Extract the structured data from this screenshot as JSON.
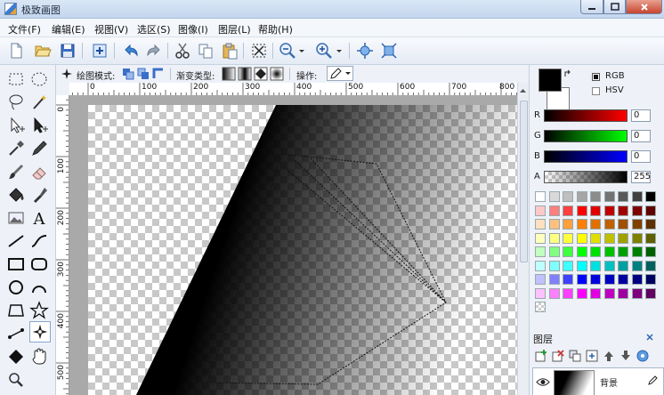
{
  "window": {
    "title": "极致画图"
  },
  "menu": [
    "文件(F)",
    "编辑(E)",
    "视图(V)",
    "选区(S)",
    "图像(I)",
    "图层(L)",
    "帮助(H)"
  ],
  "options": {
    "draw_mode_label": "绘图模式:",
    "gradient_type_label": "渐变类型:",
    "operation_label": "操作:"
  },
  "ruler": {
    "h_labels": [
      "0",
      "100",
      "200",
      "300",
      "400",
      "500",
      "600",
      "700",
      "800"
    ],
    "v_labels": [
      "0",
      "100",
      "200",
      "300",
      "400",
      "500"
    ]
  },
  "color": {
    "mode_rgb": "RGB",
    "mode_hsv": "HSV",
    "rgb_selected": true,
    "channels": [
      {
        "label": "R",
        "value": "0"
      },
      {
        "label": "G",
        "value": "0"
      },
      {
        "label": "B",
        "value": "0"
      },
      {
        "label": "A",
        "value": "255"
      }
    ],
    "primary": "#000000",
    "secondary": "#ffffff"
  },
  "palette": [
    [
      "#ffffff",
      "#d9d9d9",
      "#bfbfbf",
      "#a6a6a6",
      "#8c8c8c",
      "#737373",
      "#595959",
      "#404040",
      "#000000"
    ],
    [
      "#ffc9c9",
      "#ff7f7f",
      "#ff4040",
      "#ff0000",
      "#e00000",
      "#c00000",
      "#a00000",
      "#800000",
      "#600000"
    ],
    [
      "#ffe0c0",
      "#ffc080",
      "#ffa040",
      "#ff8000",
      "#e07000",
      "#c06000",
      "#a05000",
      "#804000",
      "#603000"
    ],
    [
      "#ffffc0",
      "#ffff80",
      "#ffff40",
      "#ffff00",
      "#e0e000",
      "#c0c000",
      "#a0a000",
      "#808000",
      "#606000"
    ],
    [
      "#c0ffc0",
      "#80ff80",
      "#40ff40",
      "#00ff00",
      "#00e000",
      "#00c000",
      "#00a000",
      "#008000",
      "#006000"
    ],
    [
      "#c0ffff",
      "#80ffff",
      "#40ffff",
      "#00ffff",
      "#00e0e0",
      "#00c0c0",
      "#00a0a0",
      "#008080",
      "#006060"
    ],
    [
      "#c0c0ff",
      "#8080ff",
      "#4040ff",
      "#0000ff",
      "#0000e0",
      "#0000c0",
      "#0000a0",
      "#000080",
      "#000060"
    ],
    [
      "#ffc0ff",
      "#ff80ff",
      "#ff40ff",
      "#ff00ff",
      "#e000e0",
      "#c000c0",
      "#a000a0",
      "#800080",
      "#600060"
    ]
  ],
  "layers": {
    "title": "图层",
    "items": [
      {
        "name": "背景"
      }
    ]
  }
}
